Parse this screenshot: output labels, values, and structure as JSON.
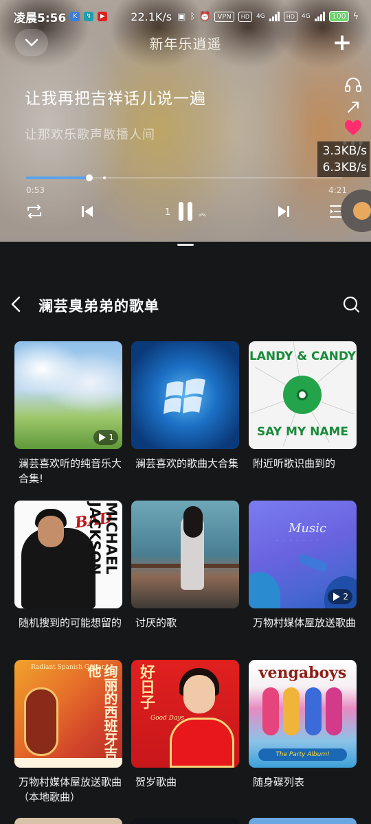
{
  "status_bar": {
    "time": "凌晨5:56",
    "net_speed": "22.1K/s",
    "vpn_badge": "VPN",
    "hd1": "HD",
    "net1": "4G",
    "hd2": "HD",
    "net2": "4G",
    "battery": "100"
  },
  "player": {
    "song_title": "新年乐逍遥",
    "lyric_current": "让我再把吉祥话儿说一遍",
    "lyric_next": "让那欢乐歌声散播人间",
    "current_time": "0:53",
    "total_time": "4:21",
    "progress_fraction": 0.2,
    "playlist_position": "1",
    "net_up": "3.3KB/s",
    "net_down": "6.3KB/s",
    "accent_color": "#5aa2ee",
    "liked_color": "#ff2d6f"
  },
  "playlist": {
    "title": "澜芸臭弟弟的歌单",
    "cards": [
      {
        "title": "澜芸喜欢听的纯音乐大合集!",
        "count": "1",
        "cover_icon": "sky-meadow-art"
      },
      {
        "title": "澜芸喜欢的歌曲大合集",
        "count": "",
        "cover_icon": "windows-logo-art"
      },
      {
        "title": "附近听歌识曲到的",
        "count": "",
        "cover_icon": "vinyl-record-art",
        "cover_text_top": "LANDY & CANDY",
        "cover_text_bottom": "SAY MY NAME"
      },
      {
        "title": "随机搜到的可能想留的",
        "count": "",
        "cover_icon": "album-portrait-art",
        "cover_text_name": "MICHAEL JACKSON",
        "cover_text_bad": "BAD"
      },
      {
        "title": "讨厌的歌",
        "count": "",
        "cover_icon": "girl-by-window-art"
      },
      {
        "title": "万物村媒体屋放送歌曲",
        "count": "2",
        "cover_icon": "music-illustration-art",
        "cover_text_music": "Music"
      },
      {
        "title": "万物村媒体屋放送歌曲（本地歌曲）",
        "count": "",
        "cover_icon": "guitar-art",
        "cover_text_en": "Radiant Spanish Guitar",
        "cover_text_cn": "绚丽的西班牙吉他"
      },
      {
        "title": "贺岁歌曲",
        "count": "",
        "cover_icon": "singer-portrait-art",
        "cover_text_cn": "好日子",
        "cover_text_en": "Good Days"
      },
      {
        "title": "随身碟列表",
        "count": "",
        "cover_icon": "cartoon-band-art",
        "cover_text_logo": "vengaboys",
        "cover_text_banner": "The Party Album!"
      }
    ]
  }
}
